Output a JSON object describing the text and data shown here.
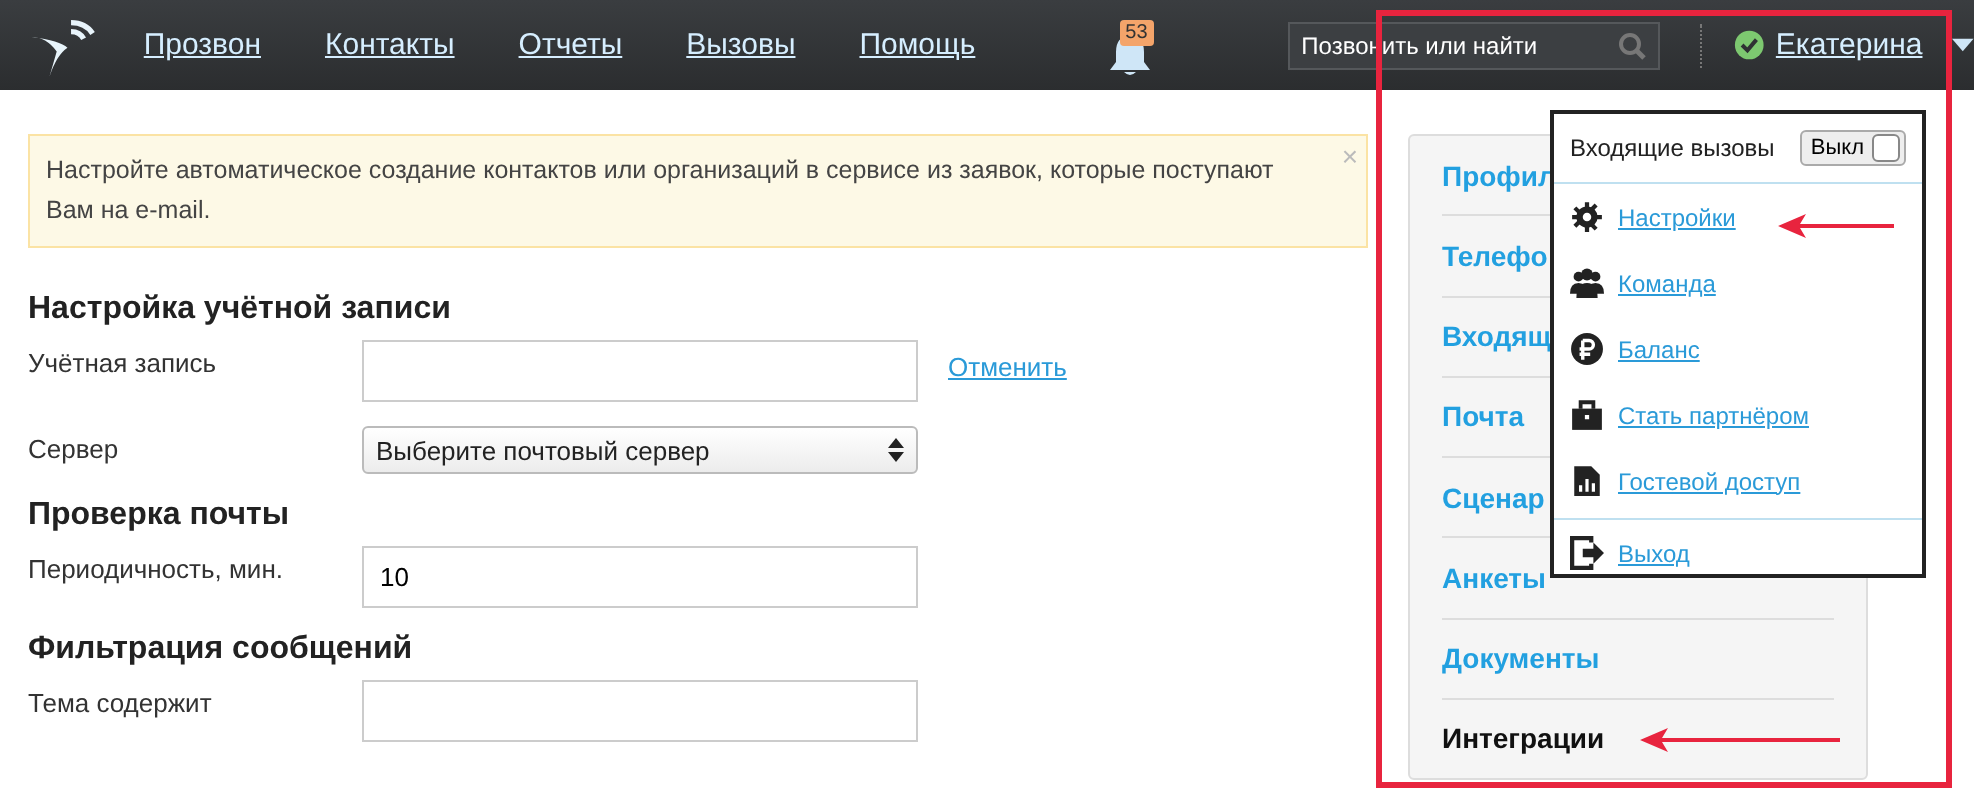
{
  "nav": {
    "links": [
      "Прозвон",
      "Контакты",
      "Отчеты",
      "Вызовы",
      "Помощь"
    ],
    "notifications": "53",
    "search": {
      "placeholder": "Позвонить или найти"
    },
    "user": {
      "name": "Екатерина",
      "online": true
    }
  },
  "banner": {
    "text": "Настройте автоматическое создание контактов или организаций в сервисе из заявок, которые поступают Вам на e-mail.",
    "close": "×"
  },
  "form": [
    {
      "title": "Настройка учётной записи",
      "fields": [
        {
          "kind": "text",
          "label": "Учётная запись",
          "link": "Отменить"
        },
        {
          "kind": "select",
          "label": "Сервер",
          "value": "Выберите почтовый сервер"
        }
      ]
    },
    {
      "title": "Проверка почты",
      "fields": [
        {
          "kind": "text",
          "label": "Периодичность, мин.",
          "value": "10"
        }
      ]
    },
    {
      "title": "Фильтрация сообщений",
      "fields": [
        {
          "kind": "text",
          "label": "Тема содержит"
        }
      ]
    }
  ],
  "side_menu": [
    {
      "label": "Профил",
      "selected": false
    },
    {
      "label": "Телефо",
      "selected": false
    },
    {
      "label": "Входящ",
      "selected": false
    },
    {
      "label": "Почта",
      "selected": false
    },
    {
      "label": "Сценар",
      "selected": false
    },
    {
      "label": "Анкеты",
      "selected": false
    },
    {
      "label": "Документы",
      "selected": false
    },
    {
      "label": "Интеграции",
      "selected": true
    }
  ],
  "dropdown": {
    "toggle": {
      "label": "Входящие вызовы",
      "value": "Выкл",
      "on": false
    },
    "items": [
      {
        "label": "Настройки"
      },
      {
        "label": "Команда"
      },
      {
        "label": "Баланс"
      },
      {
        "label": "Стать партнёром"
      },
      {
        "label": "Гостевой доступ"
      },
      {
        "label": "Выход"
      }
    ]
  }
}
